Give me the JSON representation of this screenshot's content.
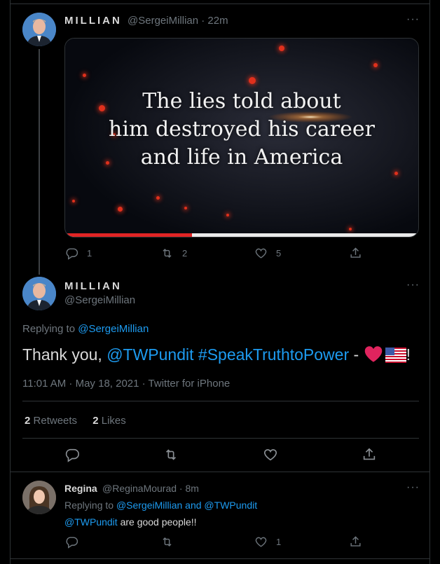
{
  "tweet1": {
    "name": "MILLIAN",
    "handle": "@SergeiMillian · 22m",
    "more": "···",
    "media_text_line1": "The lies told about",
    "media_text_line2": "him destroyed his career",
    "media_text_line3": "and life in America",
    "video_progress": 0.36,
    "actions": {
      "replies": "1",
      "retweets": "2",
      "likes": "5"
    }
  },
  "tweet2": {
    "name": "MILLIAN",
    "handle": "@SergeiMillian",
    "more": "···",
    "replying_prefix": "Replying to ",
    "replying_user": "@SergeiMillian",
    "text_start": "Thank you, ",
    "mention": "@TWPundit",
    "hashtag": "#SpeakTruthtoPower",
    "text_dash": " - ",
    "text_end": "!",
    "timestamp": "11:01 AM · May 18, 2021 · Twitter for iPhone",
    "retweets_count": "2",
    "retweets_label": "Retweets",
    "likes_count": "2",
    "likes_label": "Likes"
  },
  "tweet3": {
    "name": "Regina",
    "handle": "@ReginaMourad · 8m",
    "more": "···",
    "replying_prefix": "Replying to ",
    "replying_users": "@SergeiMillian and @TWPundit",
    "mention": "@TWPundit",
    "text": " are good people!!",
    "actions": {
      "likes": "1"
    }
  },
  "colors": {
    "link": "#1d9bf0",
    "muted": "#6e767d",
    "heart": "#e0245e"
  }
}
